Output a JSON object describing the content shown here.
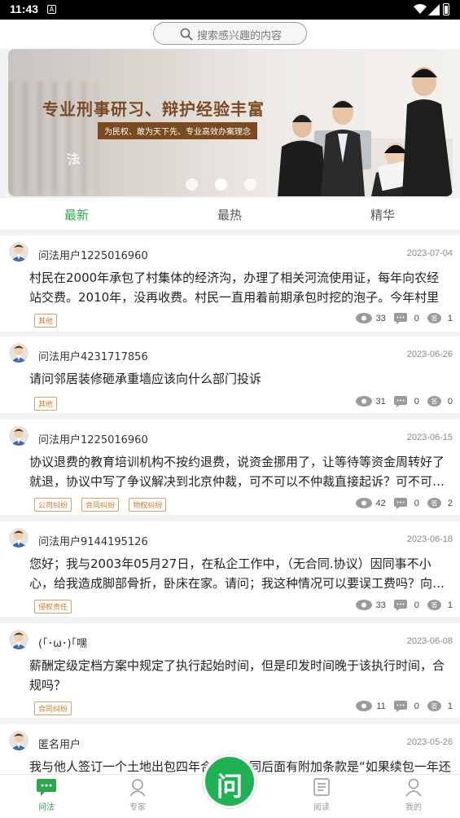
{
  "status": {
    "time": "11:43",
    "notif_icon": "A"
  },
  "search": {
    "placeholder": "搜索感兴趣的内容"
  },
  "banner": {
    "headline": "专业刑事研习、辩护经验丰富",
    "tagline": "为民权、敢为天下先、专业高效办案理念",
    "seal": "法",
    "dots": 3,
    "active_dot": 1
  },
  "tabs": [
    "最新",
    "最热",
    "精华"
  ],
  "active_tab": 0,
  "posts": [
    {
      "user": "问法用户1225016960",
      "date": "2023-07-04",
      "question": "村民在2000年承包了村集体的经济沟，办理了相关河流使用证，每年向农经站交费。2010年，没再收费。村民一直用着前期承包时挖的泡子。今年村里将…",
      "tags": [
        "其他"
      ],
      "views": "33",
      "comments": "0",
      "answers": "1"
    },
    {
      "user": "问法用户4231717856",
      "date": "2023-06-26",
      "question": "请问邻居装修砸承重墙应该向什么部门投诉",
      "tags": [
        "其他"
      ],
      "views": "31",
      "comments": "0",
      "answers": "0"
    },
    {
      "user": "问法用户1225016960",
      "date": "2023-06-15",
      "question": "协议退费的教育培训机构不按约退费，说资金挪用了，让等待等资金周转好了就退，协议中写了争议解决到北京仲裁，可不可以不仲裁直接起诉？可不可…",
      "tags": [
        "公司纠纷",
        "合同纠纷",
        "物权纠纷"
      ],
      "views": "42",
      "comments": "0",
      "answers": "2"
    },
    {
      "user": "问法用户9144195126",
      "date": "2023-06-18",
      "question": "您好；我与2003年05月27日，在私企工作中，（无合同.协议）因同事不小心，给我造成脚部骨折，卧床在家。请问；我这种情况可以要误工费吗？向…",
      "tags": [
        "侵权责任"
      ],
      "views": "33",
      "comments": "0",
      "answers": "1"
    },
    {
      "user": "(｢･ω･)｢嘿",
      "date": "2023-06-08",
      "question": "薪酬定级定档方案中规定了执行起始时间，但是印发时间晚于该执行时间，合规吗？",
      "tags": [
        "合同纠纷"
      ],
      "views": "11",
      "comments": "0",
      "answers": "1"
    },
    {
      "user": "匿名用户",
      "date": "2023-05-26",
      "question": "我与他人签订一个土地出包四年合同，合同后面有附加条款是“如果续包一年还"
    }
  ],
  "nav": {
    "items": [
      "问法",
      "专家",
      "阅读",
      "我的"
    ],
    "active": 0,
    "ask_label": "问"
  },
  "colors": {
    "accent": "#2aa84a",
    "ask_button": "#1fb153",
    "tag": "#d07a2a"
  }
}
